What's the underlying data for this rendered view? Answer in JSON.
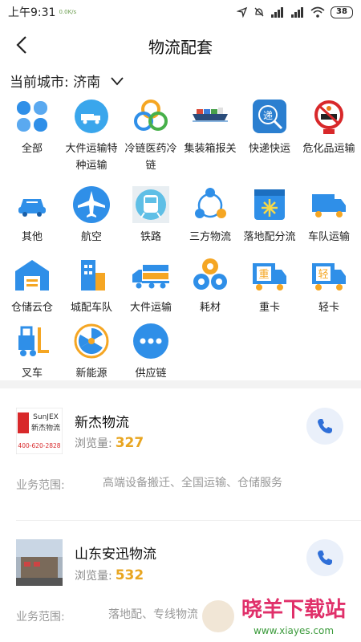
{
  "status_bar": {
    "time": "上午9:31",
    "hd_text": "0.0K/s",
    "battery": "38"
  },
  "header": {
    "title": "物流配套"
  },
  "city": {
    "label": "当前城市: 济南"
  },
  "categories": [
    {
      "label": "全部",
      "icon": "four-petal-icon"
    },
    {
      "label": "大件运输特种运输",
      "icon": "truck-circle-icon"
    },
    {
      "label": "冷链医药冷链",
      "icon": "cold-chain-rings-icon"
    },
    {
      "label": "集装箱报关",
      "icon": "container-ship-icon"
    },
    {
      "label": "快递快运",
      "icon": "express-search-icon"
    },
    {
      "label": "危化品运输",
      "icon": "hazard-sign-icon"
    },
    {
      "label": "其他",
      "icon": "car-wrench-icon"
    },
    {
      "label": "航空",
      "icon": "airplane-icon"
    },
    {
      "label": "铁路",
      "icon": "train-icon"
    },
    {
      "label": "三方物流",
      "icon": "network-nodes-icon"
    },
    {
      "label": "落地配分流",
      "icon": "snowflake-box-icon"
    },
    {
      "label": "车队运输",
      "icon": "box-truck-icon"
    },
    {
      "label": "仓储云仓",
      "icon": "warehouse-icon"
    },
    {
      "label": "城配车队",
      "icon": "city-building-icon"
    },
    {
      "label": "大件运输",
      "icon": "cargo-truck-icon"
    },
    {
      "label": "耗材",
      "icon": "pipe-rolls-icon"
    },
    {
      "label": "重卡",
      "icon": "heavy-truck-icon"
    },
    {
      "label": "轻卡",
      "icon": "light-truck-icon"
    },
    {
      "label": "叉车",
      "icon": "forklift-icon"
    },
    {
      "label": "新能源",
      "icon": "radiation-icon"
    },
    {
      "label": "供应链",
      "icon": "more-dots-icon"
    }
  ],
  "companies": [
    {
      "name": "新杰物流",
      "views_label": "浏览量:",
      "views": "327",
      "scope_label": "业务范围:",
      "scope": "高端设备搬迁、全国运输、仓储服务",
      "logo_line1": "SunJEX",
      "logo_line2": "新杰物流",
      "logo_phone": "400-620-2828"
    },
    {
      "name": "山东安迅物流",
      "views_label": "浏览量:",
      "views": "532",
      "scope_label": "业务范围:",
      "scope": "落地配、专线物流"
    }
  ],
  "watermark": {
    "text": "晓羊下载站",
    "url": "www.xiayes.com"
  },
  "colors": {
    "accent": "#2f8fe8",
    "orange": "#f5a623",
    "views": "#e8a520"
  }
}
